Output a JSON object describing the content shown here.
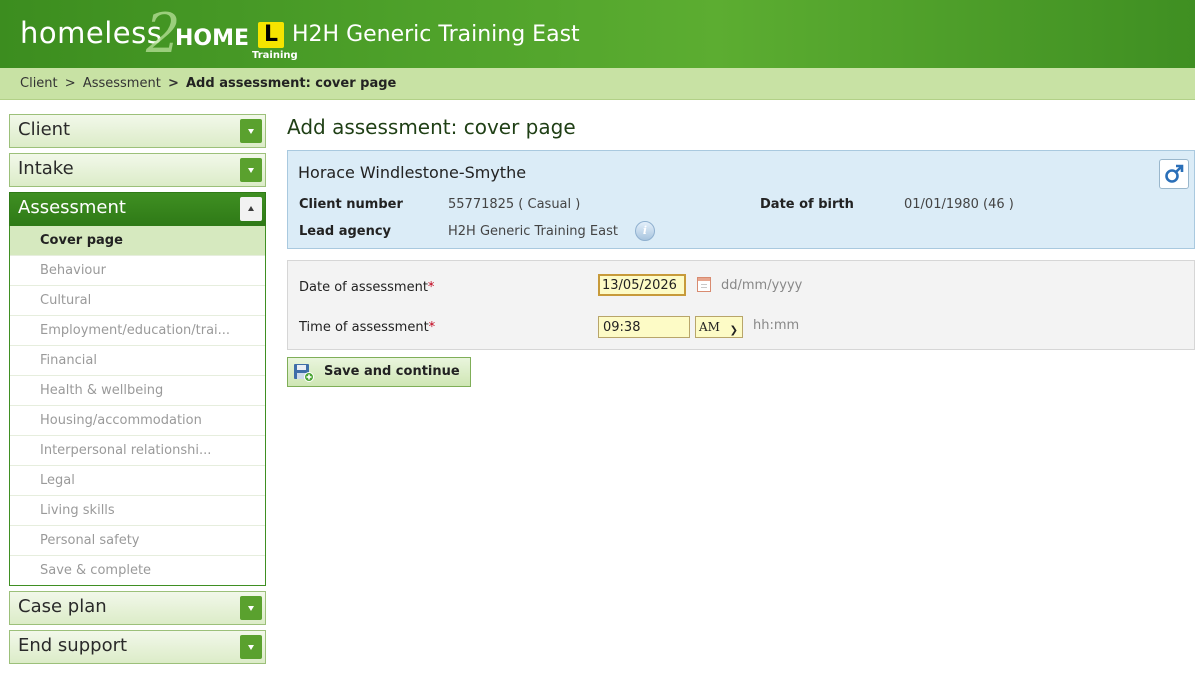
{
  "header": {
    "logo_homeless": "homeless",
    "logo_two": "2",
    "logo_home": "HOME",
    "logo_l": "L",
    "logo_training": "Training",
    "title": "H2H Generic Training East"
  },
  "breadcrumb": {
    "items": [
      "Client",
      "Assessment"
    ],
    "separator": ">",
    "current": "Add assessment: cover page"
  },
  "sidebar": {
    "client": "Client",
    "intake": "Intake",
    "assessment": "Assessment",
    "case_plan": "Case plan",
    "end_support": "End support",
    "assessment_items": [
      "Cover page",
      "Behaviour",
      "Cultural",
      "Employment/education/trai...",
      "Financial",
      "Health & wellbeing",
      "Housing/accommodation",
      "Interpersonal relationshi...",
      "Legal",
      "Living skills",
      "Personal safety",
      "Save & complete"
    ],
    "active_item": "Cover page"
  },
  "main": {
    "page_title": "Add assessment: cover page",
    "client": {
      "name": "Horace Windlestone-Smythe",
      "client_number_label": "Client number",
      "client_number": "55771825 ( Casual )",
      "lead_agency_label": "Lead agency",
      "lead_agency": "H2H Generic Training East",
      "dob_label": "Date of birth",
      "dob": "01/01/1980 (46 )",
      "gender_icon": "male-symbol-icon",
      "info_icon": "info-icon"
    },
    "form": {
      "date_label": "Date of assessment",
      "date_value": "13/05/2026",
      "date_hint": "dd/mm/yyyy",
      "time_label": "Time of assessment",
      "time_value": "09:38",
      "ampm_value": "AM",
      "time_hint": "hh:mm",
      "required_mark": "*"
    },
    "save_button": "Save and continue"
  },
  "colors": {
    "header_green": "#4ea12a",
    "breadcrumb_bg": "#c8e2a4",
    "client_box_bg": "#dbecf7",
    "input_bg": "#fdfbc6",
    "required": "#c0001a"
  }
}
